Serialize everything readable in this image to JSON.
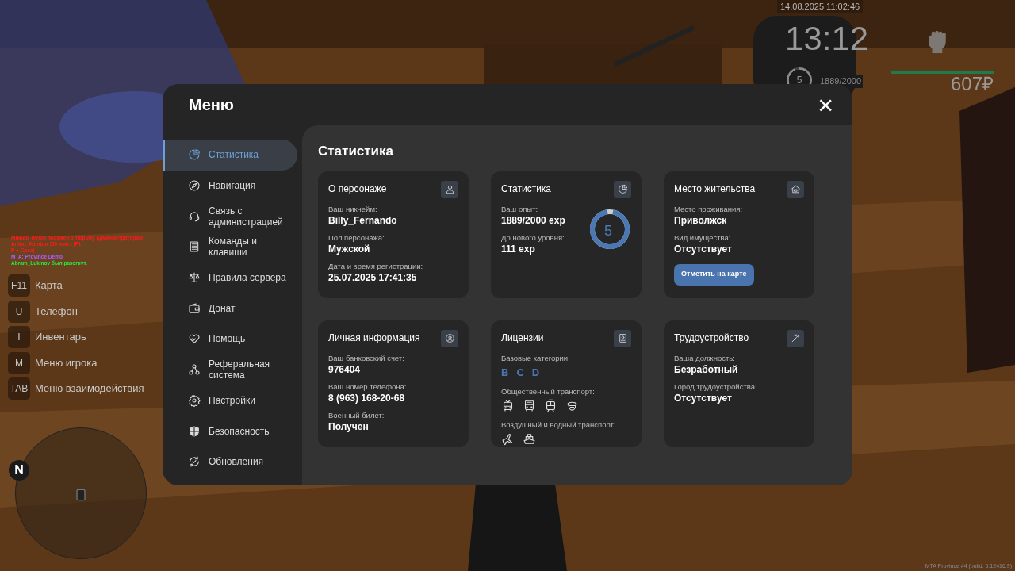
{
  "hud": {
    "datetime": "14.08.2025 11:02:46",
    "clock": "13:12",
    "player_level": "5",
    "level_ring": {
      "level": 0.945
    },
    "exp": "1889/2000",
    "health": {
      "level": 1.0
    },
    "money": "607₽"
  },
  "key_hints": [
    {
      "key": "F11",
      "label": "Карта"
    },
    {
      "key": "U",
      "label": "Телефон"
    },
    {
      "key": "I",
      "label": "Инвентарь"
    },
    {
      "key": "M",
      "label": "Меню игрока"
    },
    {
      "key": "TAB",
      "label": "Меню взаимодействия"
    }
  ],
  "chat": [
    {
      "text": "Mikhail_Ivekin посажен в тюрьму администратором Anton_Kambur (60 мин.) (F1",
      "color": "#ff1a1a"
    },
    {
      "text": "P + Срез)",
      "color": "#ff1a1a"
    },
    {
      "text": "MTA: Province Demo",
      "color": "#b05cff"
    },
    {
      "text": "Abram_Lukinov был разогнут.",
      "color": "#2ee83a"
    }
  ],
  "minimap": {
    "north": "N"
  },
  "build": "MTA Province #4 (build: 6.12416.9)",
  "menu": {
    "title": "Меню",
    "close": "×",
    "sidebar": [
      {
        "label": "Статистика",
        "selected": true
      },
      {
        "label": "Навигация",
        "selected": false
      },
      {
        "label": "Связь с администрацией",
        "selected": false
      },
      {
        "label": "Команды и клавиши",
        "selected": false
      },
      {
        "label": "Правила сервера",
        "selected": false
      },
      {
        "label": "Донат",
        "selected": false
      },
      {
        "label": "Помощь",
        "selected": false
      },
      {
        "label": "Реферальная система",
        "selected": false
      },
      {
        "label": "Настройки",
        "selected": false
      },
      {
        "label": "Безопасность",
        "selected": false
      },
      {
        "label": "Обновления",
        "selected": false
      }
    ],
    "section_title": "Статистика",
    "cards": [
      {
        "kind": "fields",
        "title": "О персонаже",
        "fields": [
          {
            "label": "Ваш никнейм:",
            "value": "Billy_Fernando"
          },
          {
            "label": "Пол персонажа:",
            "value": "Мужской"
          },
          {
            "label": "Дата и время регистрации:",
            "value": "25.07.2025 17:41:35"
          }
        ]
      },
      {
        "kind": "stats",
        "title": "Статистика",
        "fields": [
          {
            "label": "Ваш опыт:",
            "value": "1889/2000 exp"
          },
          {
            "label": "До нового уровня:",
            "value": "111 exp"
          }
        ],
        "level_label": "5",
        "level": 0.945
      },
      {
        "kind": "fields",
        "title": "Место жительства",
        "fields": [
          {
            "label": "Место проживания:",
            "value": "Приволжск"
          },
          {
            "label": "Вид имущества:",
            "value": "Отсутствует"
          }
        ],
        "button": "Отметить на карте"
      },
      {
        "kind": "fields",
        "title": "Личная информация",
        "fields": [
          {
            "label": "Ваш банковский счет:",
            "value": "976404"
          },
          {
            "label": "Ваш номер телефона:",
            "value": "8 (963) 168-20-68"
          },
          {
            "label": "Военный билет:",
            "value": "Получен"
          }
        ]
      },
      {
        "kind": "licenses",
        "title": "Лицензии",
        "groups": [
          {
            "kind": "letters",
            "label": "Базовые категории:",
            "items": [
              "B",
              "C",
              "D"
            ]
          },
          {
            "kind": "icons",
            "label": "Общественный транспорт:"
          },
          {
            "kind": "icons",
            "label": "Воздушный и водный транспорт:"
          }
        ]
      },
      {
        "kind": "fields",
        "title": "Трудоустройство",
        "fields": [
          {
            "label": "Ваша должность:",
            "value": "Безработный"
          },
          {
            "label": "Город трудоустройства:",
            "value": "Отсутствует"
          }
        ]
      }
    ]
  }
}
